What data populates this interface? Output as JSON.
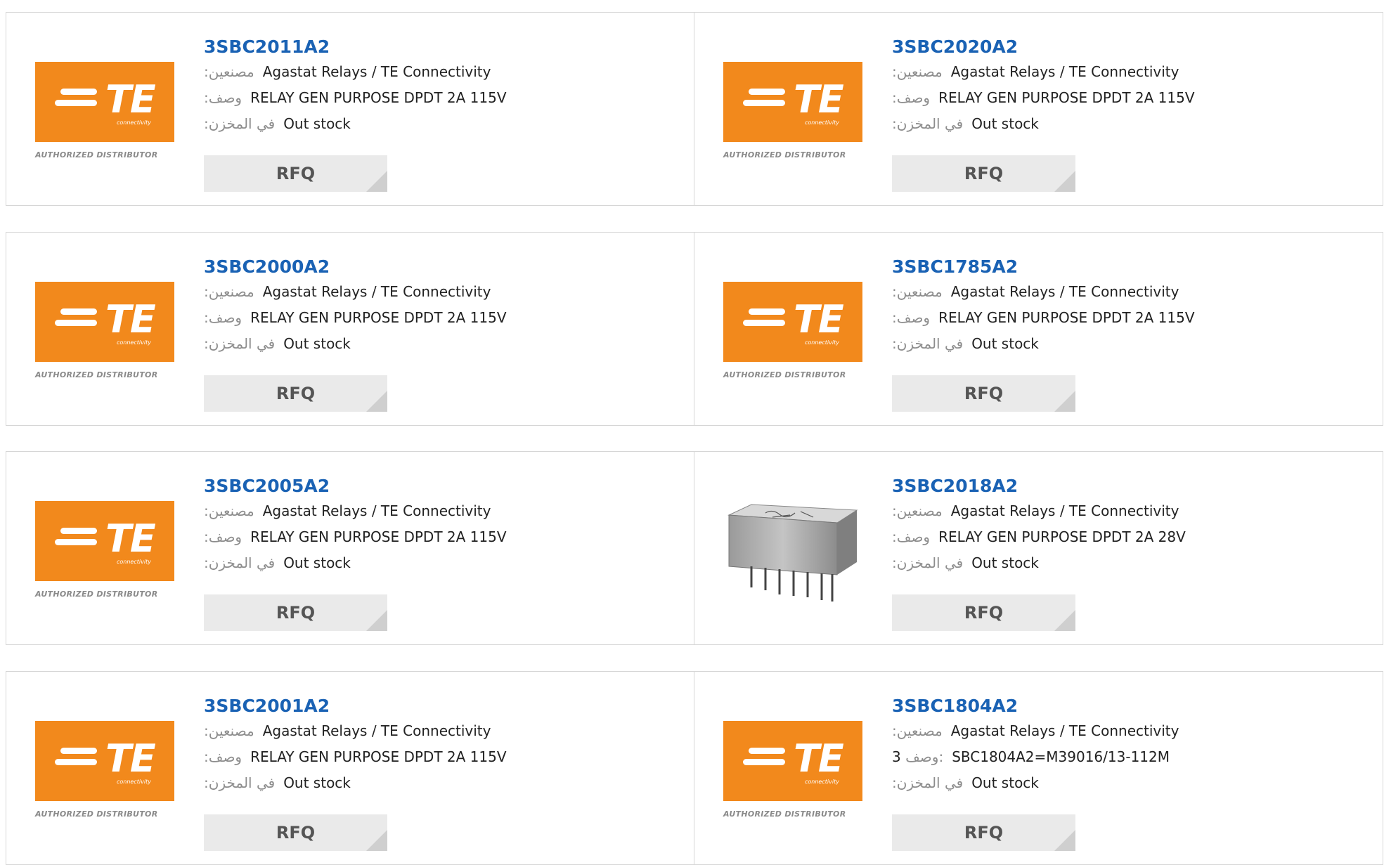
{
  "labels": {
    "manufacturer": ":مصنعين",
    "description": ":وصف",
    "stock": ":في المخزن",
    "rfq": "RFQ"
  },
  "logo": {
    "brand": "TE",
    "sub": "connectivity",
    "caption": "AUTHORIZED DISTRIBUTOR",
    "color": "#f2891c"
  },
  "colors": {
    "part_link": "#1a62b4",
    "label": "#8d8d8d",
    "button_bg": "#eaeaea"
  },
  "products": [
    {
      "part": "3SBC2011A2",
      "manufacturer": "Agastat Relays / TE Connectivity",
      "description": "RELAY GEN PURPOSE DPDT 2A 115V",
      "stock": "Out stock",
      "image": "te-logo"
    },
    {
      "part": "3SBC2020A2",
      "manufacturer": "Agastat Relays / TE Connectivity",
      "description": "RELAY GEN PURPOSE DPDT 2A 115V",
      "stock": "Out stock",
      "image": "te-logo"
    },
    {
      "part": "3SBC2000A2",
      "manufacturer": "Agastat Relays / TE Connectivity",
      "description": "RELAY GEN PURPOSE DPDT 2A 115V",
      "stock": "Out stock",
      "image": "te-logo"
    },
    {
      "part": "3SBC1785A2",
      "manufacturer": "Agastat Relays / TE Connectivity",
      "description": "RELAY GEN PURPOSE DPDT 2A 115V",
      "stock": "Out stock",
      "image": "te-logo"
    },
    {
      "part": "3SBC2005A2",
      "manufacturer": "Agastat Relays / TE Connectivity",
      "description": "RELAY GEN PURPOSE DPDT 2A 115V",
      "stock": "Out stock",
      "image": "te-logo"
    },
    {
      "part": "3SBC2018A2",
      "manufacturer": "Agastat Relays / TE Connectivity",
      "description": "RELAY GEN PURPOSE DPDT 2A 28V",
      "stock": "Out stock",
      "image": "relay-photo"
    },
    {
      "part": "3SBC2001A2",
      "manufacturer": "Agastat Relays / TE Connectivity",
      "description": "RELAY GEN PURPOSE DPDT 2A 115V",
      "stock": "Out stock",
      "image": "te-logo"
    },
    {
      "part": "3SBC1804A2",
      "manufacturer": "Agastat Relays / TE Connectivity",
      "description_prefix": "3",
      "description_label": "وصف:",
      "description": "SBC1804A2=M39016/13-112M",
      "stock": "Out stock",
      "image": "te-logo"
    }
  ]
}
